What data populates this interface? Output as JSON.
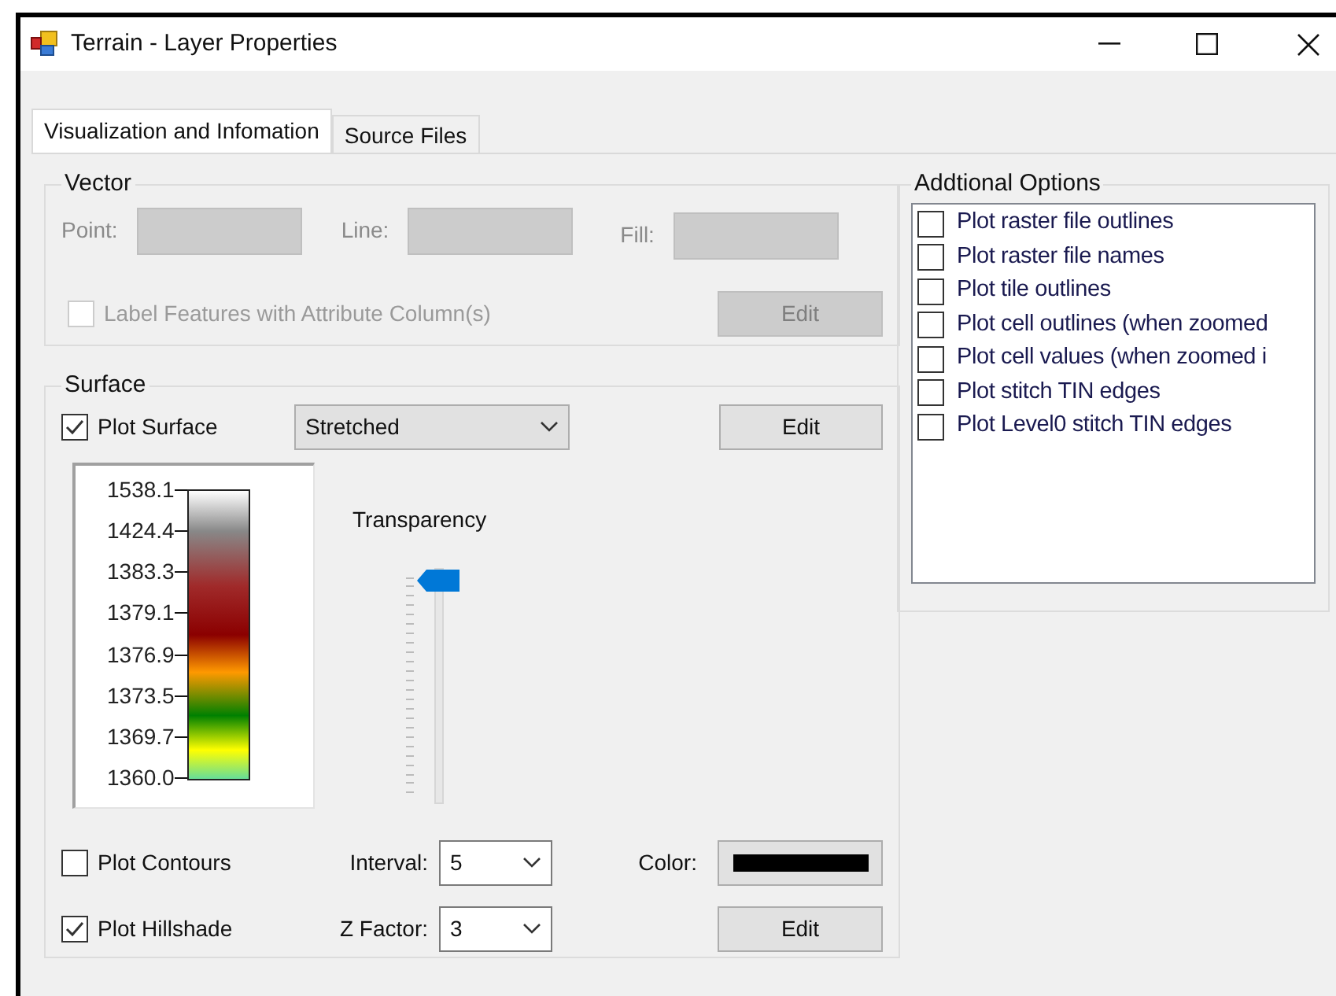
{
  "window": {
    "title": "Terrain - Layer Properties"
  },
  "tabs": [
    {
      "label": "Visualization and Infomation",
      "selected": true
    },
    {
      "label": "Source Files",
      "selected": false
    }
  ],
  "vector": {
    "title": "Vector",
    "disabled": true,
    "swatches": [
      {
        "label": "Point:"
      },
      {
        "label": "Line:"
      },
      {
        "label": "Fill:"
      }
    ],
    "label_features": {
      "label": "Label Features with Attribute Column(s)",
      "checked": false
    },
    "edit_button": "Edit"
  },
  "surface": {
    "title": "Surface",
    "plot_surface": {
      "label": "Plot Surface",
      "checked": true
    },
    "renderer": {
      "value": "Stretched"
    },
    "edit_button": "Edit",
    "legend": {
      "labels": [
        "1538.1",
        "1424.4",
        "1383.3",
        "1379.1",
        "1376.9",
        "1373.5",
        "1369.7",
        "1360.0"
      ]
    },
    "transparency": {
      "label": "Transparency",
      "level": 1
    },
    "contours": {
      "label": "Plot Contours",
      "checked": false
    },
    "interval": {
      "label": "Interval:",
      "value": "5"
    },
    "color": {
      "label": "Color:",
      "color": "#000000"
    },
    "hillshade": {
      "label": "Plot Hillshade",
      "checked": true
    },
    "z_factor": {
      "label": "Z Factor:",
      "value": "3"
    },
    "hillshade_edit": "Edit"
  },
  "additional_options": {
    "title": "Addtional Options",
    "items": [
      {
        "label": "Plot raster file outlines",
        "checked": false
      },
      {
        "label": "Plot raster file names",
        "checked": false
      },
      {
        "label": "Plot tile outlines",
        "checked": false
      },
      {
        "label": "Plot cell outlines (when zoomed",
        "checked": false
      },
      {
        "label": "Plot cell values (when zoomed i",
        "checked": false
      },
      {
        "label": "Plot stitch TIN edges",
        "checked": false
      },
      {
        "label": "Plot Level0 stitch TIN edges",
        "checked": false
      }
    ]
  }
}
